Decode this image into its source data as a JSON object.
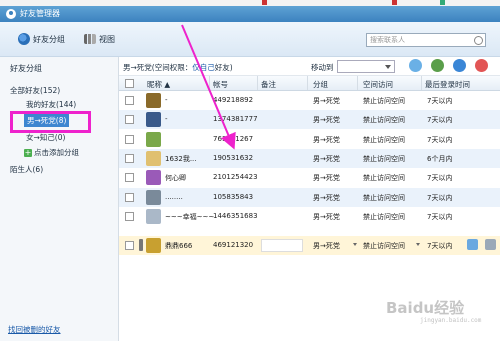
{
  "window": {
    "title": "好友管理器"
  },
  "toolbar": {
    "tab_groups": "好友分组",
    "tab_view": "视图",
    "search_placeholder": "搜索联系人"
  },
  "sidebar": {
    "header": "好友分组",
    "groups": [
      {
        "label": "全部好友(152)"
      },
      {
        "label": "我的好友(144)"
      },
      {
        "label": "男→死党(8)"
      },
      {
        "label": "女→知己(0)"
      },
      {
        "label": "点击添加分组"
      },
      {
        "label": "陌生人(6)"
      }
    ],
    "recover_link": "找回被删的好友"
  },
  "content_header": {
    "group_name": "男→死党(空间权限：",
    "perm_link": "仅自己",
    "perm_suffix": "好友)",
    "move_to_label": "移动到"
  },
  "table": {
    "headers": [
      "昵称",
      "帐号",
      "备注",
      "分组",
      "空间访问",
      "最后登录时间"
    ],
    "rows": [
      {
        "nickname": "-",
        "account": "449218892",
        "group": "男→死党",
        "access": "禁止访问空间",
        "last_login": "7天以内",
        "avatar_color": "#8a6a2a"
      },
      {
        "nickname": "-",
        "account": "1374381777",
        "group": "男→死党",
        "access": "禁止访问空间",
        "last_login": "7天以内",
        "avatar_color": "#3a5a8a"
      },
      {
        "nickname": "",
        "account": "761271267",
        "group": "男→死党",
        "access": "禁止访问空间",
        "last_login": "7天以内",
        "avatar_color": "#7aa84a"
      },
      {
        "nickname": "1632我...",
        "account": "190531632",
        "group": "男→死党",
        "access": "禁止访问空间",
        "last_login": "6个月内",
        "avatar_color": "#e0c070"
      },
      {
        "nickname": "何心卿",
        "account": "2101254423",
        "group": "男→死党",
        "access": "禁止访问空间",
        "last_login": "7天以内",
        "avatar_color": "#9a5ab8"
      },
      {
        "nickname": "........",
        "account": "105835843",
        "group": "男→死党",
        "access": "禁止访问空间",
        "last_login": "7天以内",
        "avatar_color": "#7a8a9a"
      },
      {
        "nickname": "~~~幸福~~~",
        "account": "1446351683",
        "group": "男→死党",
        "access": "禁止访问空间",
        "last_login": "7天以内",
        "avatar_color": "#aab8c8"
      },
      {
        "nickname": "鼎鼎666",
        "account": "469121320",
        "group": "男→死党",
        "access": "禁止访问空间",
        "last_login": "7天以内",
        "avatar_color": "#c8a030"
      }
    ]
  },
  "annotation": {
    "arrow_color": "#ee22cc"
  },
  "watermark": {
    "text": "Baidu经验",
    "sub": "jingyan.baidu.com"
  }
}
